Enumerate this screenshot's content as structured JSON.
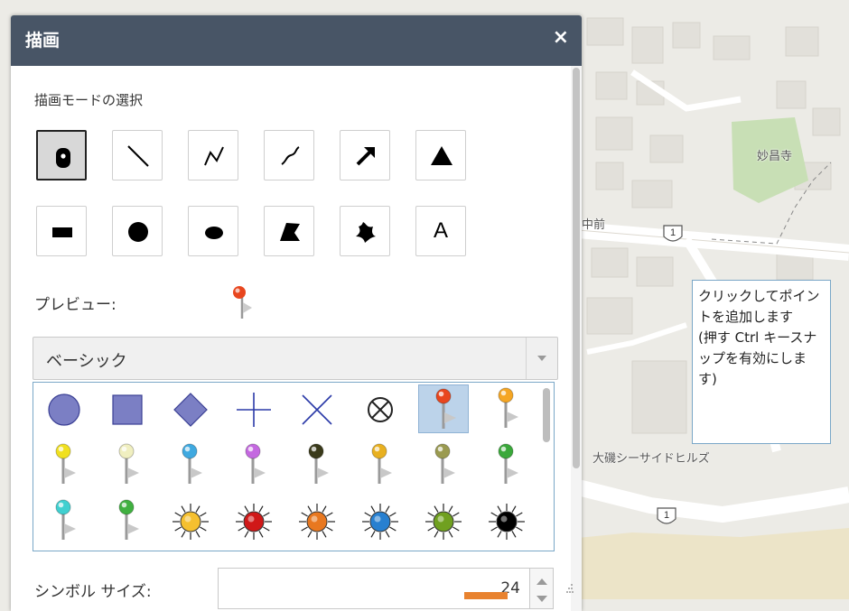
{
  "panel": {
    "title": "描画",
    "close_label": "×",
    "mode_label": "描画モードの選択",
    "preview_label": "プレビュー:",
    "style_selected": "ベーシック",
    "size_label": "シンボル サイズ:",
    "size_value": "24"
  },
  "draw_modes": [
    {
      "name": "point-mode-button",
      "icon": "point-icon",
      "active": true
    },
    {
      "name": "line-mode-button",
      "icon": "line-icon",
      "active": false
    },
    {
      "name": "polyline-mode-button",
      "icon": "polyline-icon",
      "active": false
    },
    {
      "name": "freehand-line-mode-button",
      "icon": "freehand-line-icon",
      "active": false
    },
    {
      "name": "arrow-mode-button",
      "icon": "arrow-icon",
      "active": false
    },
    {
      "name": "triangle-mode-button",
      "icon": "triangle-icon",
      "active": false
    },
    {
      "name": "rectangle-mode-button",
      "icon": "rectangle-icon",
      "active": false
    },
    {
      "name": "circle-mode-button",
      "icon": "circle-icon",
      "active": false
    },
    {
      "name": "ellipse-mode-button",
      "icon": "ellipse-icon",
      "active": false
    },
    {
      "name": "polygon-mode-button",
      "icon": "polygon-icon",
      "active": false
    },
    {
      "name": "freehand-polygon-mode-button",
      "icon": "freehand-polygon-icon",
      "active": false
    },
    {
      "name": "text-mode-button",
      "icon": "text-icon",
      "label": "A",
      "active": false
    }
  ],
  "symbols": [
    {
      "kind": "circle",
      "color": "#7b7fc4"
    },
    {
      "kind": "square",
      "color": "#7b7fc4"
    },
    {
      "kind": "diamond",
      "color": "#7b7fc4"
    },
    {
      "kind": "cross",
      "color": "#2b3aa8"
    },
    {
      "kind": "x",
      "color": "#2b3aa8"
    },
    {
      "kind": "circle-x",
      "color": "#222222"
    },
    {
      "kind": "pin",
      "color": "#e8461e",
      "selected": true
    },
    {
      "kind": "pin",
      "color": "#f5a623"
    },
    {
      "kind": "pin",
      "color": "#f0e020"
    },
    {
      "kind": "pin",
      "color": "#f0efc0"
    },
    {
      "kind": "pin",
      "color": "#3fa9e0"
    },
    {
      "kind": "pin",
      "color": "#c468e0"
    },
    {
      "kind": "pin",
      "color": "#3a3a1a"
    },
    {
      "kind": "pin",
      "color": "#e8b020"
    },
    {
      "kind": "pin",
      "color": "#9a9a50"
    },
    {
      "kind": "pin",
      "color": "#3aa83a"
    },
    {
      "kind": "pin",
      "color": "#40d0d0"
    },
    {
      "kind": "pin",
      "color": "#40b040"
    },
    {
      "kind": "sun",
      "color": "#f5c030"
    },
    {
      "kind": "sun",
      "color": "#d01818"
    },
    {
      "kind": "sun",
      "color": "#e87820"
    },
    {
      "kind": "sun",
      "color": "#2880d0"
    },
    {
      "kind": "sun",
      "color": "#70a020"
    },
    {
      "kind": "sun",
      "color": "#000000"
    }
  ],
  "map": {
    "temple_label": "妙昌寺",
    "area_label_left": "中前",
    "neighborhood_label": "大磯シーサイドヒルズ",
    "route_number_1": "1",
    "route_number_2": "1"
  },
  "tooltip": {
    "text": "クリックしてポイントを追加します\n(押す Ctrl キースナップを有効にします)"
  },
  "colors": {
    "titlebar": "#485566",
    "accent_border": "#7aa7c7",
    "selected_symbol": "#bcd3ea"
  }
}
